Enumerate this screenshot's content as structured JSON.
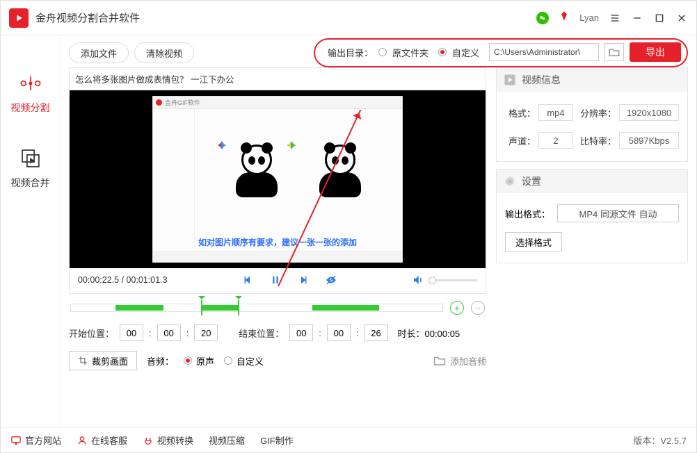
{
  "app": {
    "title": "金舟视频分割合并软件"
  },
  "user": {
    "name": "Lyan"
  },
  "sidebar": {
    "items": [
      {
        "label": "视频分割"
      },
      {
        "label": "视频合并"
      }
    ]
  },
  "toolbar": {
    "add_file": "添加文件",
    "clear_video": "清除视频",
    "output_dir_label": "输出目录：",
    "radio_original": "原文件夹",
    "radio_custom": "自定义",
    "path": "C:\\Users\\Administrator\\",
    "export": "导出"
  },
  "video": {
    "title": "怎么将多张图片做成表情包？ 一江下办公",
    "caption": "如对图片顺序有要求，建议一张一张的添加",
    "current": "00:00:22.5",
    "total": "00:01:01.3"
  },
  "cut": {
    "start_label": "开始位置：",
    "start_h": "00",
    "start_m": "00",
    "start_s": "20",
    "end_label": "结束位置：",
    "end_h": "00",
    "end_m": "00",
    "end_s": "26",
    "duration_label": "时长：",
    "duration": "00:00:05"
  },
  "crop": {
    "button": "裁剪画面",
    "audio_label": "音频：",
    "radio_original": "原声",
    "radio_custom": "自定义",
    "add_audio": "添加音频"
  },
  "info": {
    "title": "视频信息",
    "format_k": "格式：",
    "format_v": "mp4",
    "resolution_k": "分辨率：",
    "resolution_v": "1920x1080",
    "channel_k": "声道：",
    "channel_v": "2",
    "bitrate_k": "比特率：",
    "bitrate_v": "5897Kbps"
  },
  "settings": {
    "title": "设置",
    "out_format_label": "输出格式：",
    "out_format_value": "MP4 同源文件 自动",
    "choose_format": "选择格式"
  },
  "footer": {
    "website": "官方网站",
    "support": "在线客服",
    "convert": "视频转换",
    "compress": "视频压缩",
    "gif": "GIF制作",
    "version_label": "版本：",
    "version": "V2.5.7"
  }
}
